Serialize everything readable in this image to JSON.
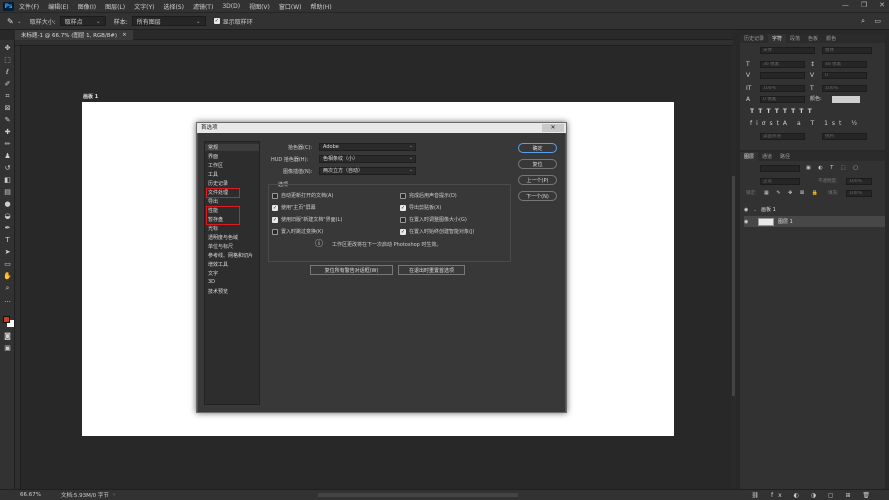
{
  "app": {
    "logo": "Ps"
  },
  "menu": [
    "文件(F)",
    "编辑(E)",
    "图像(I)",
    "图层(L)",
    "文字(Y)",
    "选择(S)",
    "滤镜(T)",
    "3D(D)",
    "视图(V)",
    "窗口(W)",
    "帮助(H)"
  ],
  "window_controls": [
    "—",
    "❐",
    "✕"
  ],
  "options_bar": {
    "sample_size_label": "取样大小:",
    "sample_size_value": "取样点",
    "sample_label": "样本:",
    "sample_value": "所有图层",
    "show_ring_label": "显示取样环"
  },
  "document_tab": {
    "title": "未标题-1 @ 66.7% (图层 1, RGB/8#)",
    "close": "×"
  },
  "artboard_label": "画板 1",
  "status": {
    "zoom": "66.67%",
    "doc": "文档:5.93M/0 字节"
  },
  "panels": {
    "top_tabs": [
      "历史记录",
      "字符",
      "段落",
      "色板",
      "颜色"
    ],
    "top_active": 1,
    "char_fields": {
      "font": "宋体",
      "style": "粗体",
      "size": "36 像素",
      "leading": "48 像素",
      "tracking": "0",
      "vscale": "100%",
      "hscale": "100%",
      "baseline": "0 像素",
      "color_label": "颜色:",
      "lang": "美国英语",
      "aa": "锐利"
    },
    "layers_tabs": [
      "图层",
      "通道",
      "路径"
    ],
    "layers_active": 0,
    "blend_mode": "正常",
    "opacity_label": "不透明度:",
    "opacity_value": "100%",
    "lock_label": "锁定:",
    "fill_label": "填充:",
    "fill_value": "100%",
    "layers": [
      {
        "name": "画板 1",
        "type": "artboard"
      },
      {
        "name": "图层 1",
        "type": "layer"
      }
    ]
  },
  "dialog": {
    "title": "首选项",
    "close": "✕",
    "nav": [
      "常规",
      "界面",
      "工作区",
      "工具",
      "历史记录",
      "文件处理",
      "导出",
      "性能",
      "暂存盘",
      "光标",
      "透明度与色域",
      "单位与标尺",
      "参考线、网格和切片",
      "增效工具",
      "文字",
      "3D",
      "技术预览"
    ],
    "nav_selected": 0,
    "highlighted": [
      5,
      7,
      8
    ],
    "picker_label": "拾色器(C):",
    "picker_value": "Adobe",
    "hud_label": "HUD 拾色器(H):",
    "hud_value": "色相条纹（小）",
    "interp_label": "图像插值(N):",
    "interp_value": "两次立方（自动）",
    "options_title": "选项",
    "options": [
      {
        "label": "自动更新打开的文档(A)",
        "checked": false
      },
      {
        "label": "完成后用声音提示(D)",
        "checked": false
      },
      {
        "label": "使用\"主页\"屏幕",
        "checked": true
      },
      {
        "label": "导出剪贴板(X)",
        "checked": true
      },
      {
        "label": "使用旧版\"新建文档\"界面(L)",
        "checked": true
      },
      {
        "label": "在置入时调整图像大小(G)",
        "checked": false
      },
      {
        "label": "置入时跳过变换(K)",
        "checked": false
      },
      {
        "label": "在置入时始终创建智能对象(J)",
        "checked": true
      }
    ],
    "info_icon": "ⓘ",
    "info_text": "工作区更改将在下一次启动 Photoshop 时生效。",
    "reset_warnings": "复位所有警告对话框(W)",
    "reset_on_quit": "在退出时重置首选项",
    "buttons": {
      "ok": "确定",
      "reset": "复位",
      "prev": "上一个(P)",
      "next": "下一个(N)"
    }
  },
  "colors": {
    "accent": "#31a8ff",
    "highlight": "#e0191e",
    "foreground": "#d23a1f",
    "background": "#ffffff"
  }
}
